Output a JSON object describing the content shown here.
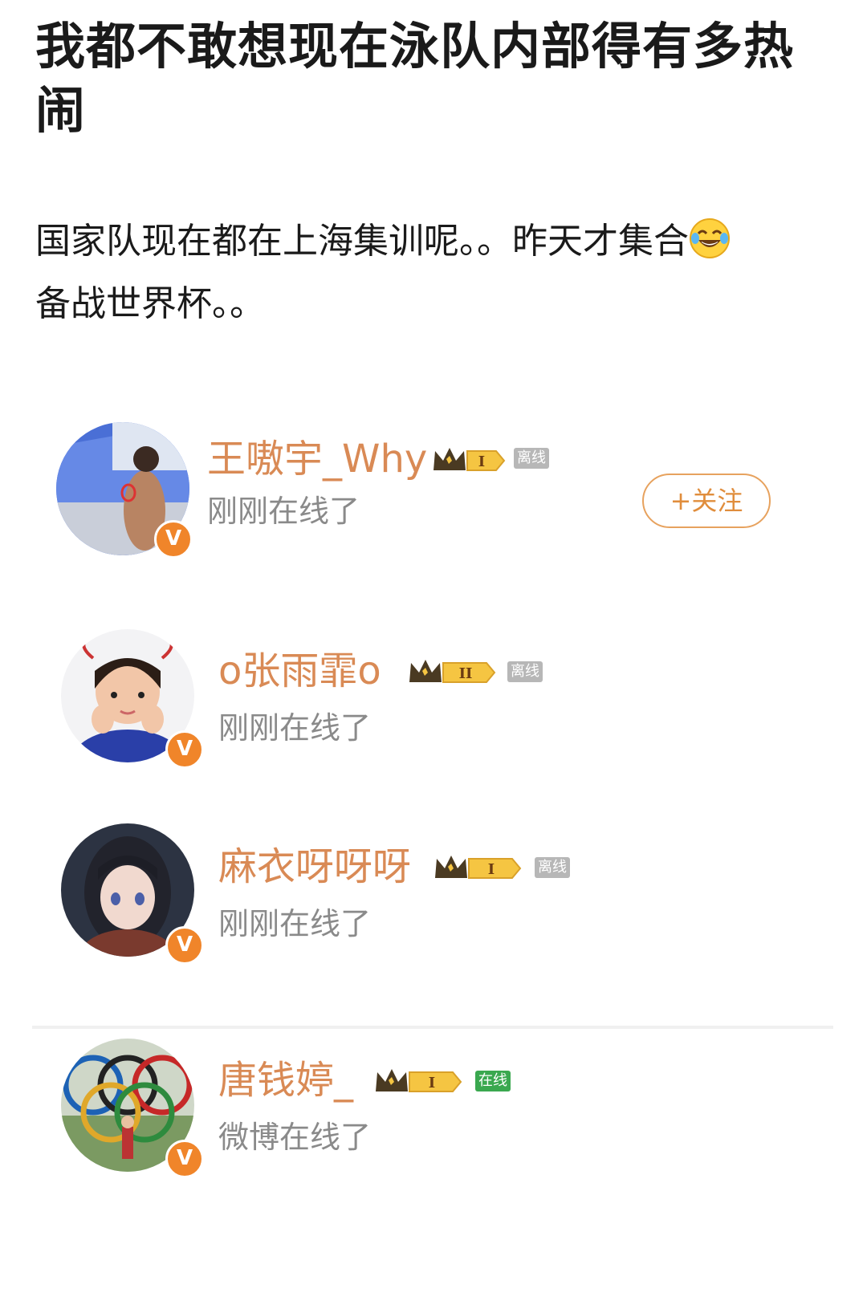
{
  "post": {
    "title": "我都不敢想现在泳队内部得有多热闹",
    "body_line1": "国家队现在都在上海集训呢。。昨天才集合",
    "body_emoji": "laughing-tears-emoji",
    "body_line2": "备战世界杯。。"
  },
  "users": [
    {
      "name": "王嗷宇_Why",
      "level": "I",
      "tag": "离线",
      "status": "刚刚在线了",
      "follow_label": "+关注"
    },
    {
      "name": "o张雨霏o",
      "level": "II",
      "tag": "离线",
      "status": "刚刚在线了"
    },
    {
      "name": "麻衣呀呀呀",
      "level": "I",
      "tag": "离线",
      "status": "刚刚在线了"
    },
    {
      "name": "唐钱婷_",
      "level": "I",
      "tag": "在线",
      "status": "微博在线了"
    }
  ],
  "badge_letter": "V",
  "colors": {
    "name": "#d98a55",
    "verified": "#f0852a",
    "online": "#3aa84f",
    "offline": "#b7b7b7",
    "follow": "#e08d3c"
  }
}
